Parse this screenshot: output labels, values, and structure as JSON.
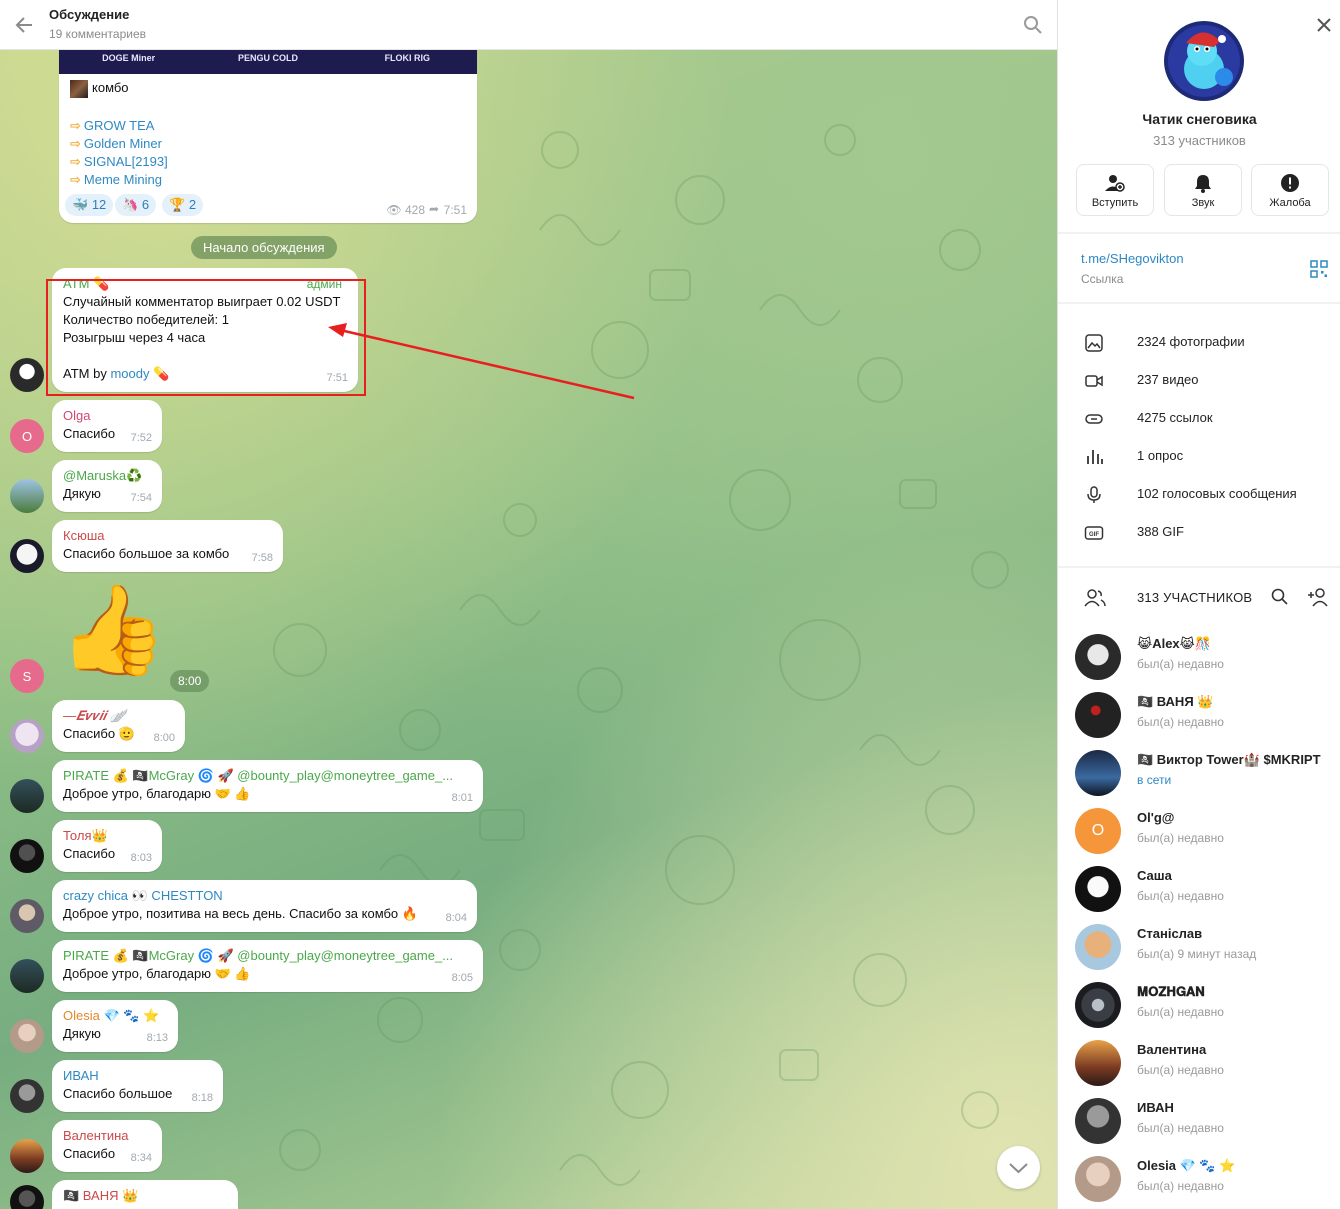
{
  "header": {
    "title": "Обсуждение",
    "subtitle": "19 комментариев"
  },
  "post": {
    "banner": [
      "DOGE Miner",
      "PENGU COLD",
      "FLOKI RIG"
    ],
    "combo": "комбо",
    "links": [
      "GROW TEA",
      "Golden Miner",
      "SIGNAL[2193]",
      "Meme Mining"
    ],
    "reactions": [
      {
        "emoji": "🐳",
        "count": "12"
      },
      {
        "emoji": "🦄",
        "count": "6"
      },
      {
        "emoji": "🏆",
        "count": "2"
      }
    ],
    "views": "428",
    "time": "7:51"
  },
  "discussion_start": "Начало обсуждения",
  "messages": [
    {
      "name": "ATM 💊",
      "badge": "админ",
      "lines": [
        "Случайный комментатор выиграет 0.02 USDT",
        "Количество победителей: 1",
        "Розыгрыш через 4 часа"
      ],
      "footer_text": "ATM by ",
      "footer_link": "moody 💊",
      "time": "7:51"
    },
    {
      "name": "Olga",
      "text": "Спасибо",
      "time": "7:52",
      "avatar_letter": "O"
    },
    {
      "name": "@Maruska♻️",
      "text": "Дякую",
      "time": "7:54"
    },
    {
      "name": "Ксюша",
      "text": "Спасибо большое за комбо",
      "time": "7:58"
    },
    {
      "sticker": "👍",
      "time": "8:00",
      "avatar_letter": "S"
    },
    {
      "name": "—𝑬𝒗𝒗𝒊𝒊 🪽",
      "text": "Спасибо 🫡",
      "time": "8:00"
    },
    {
      "name": "PIRATE 💰 🏴‍☠️McGray 🌀 🚀 @bounty_play@moneytree_game_...",
      "text": "Доброе утро, благодарю 🤝 👍",
      "time": "8:01"
    },
    {
      "name": "Толя👑",
      "text": "Спасибо",
      "time": "8:03"
    },
    {
      "name": "crazy chica 👀 CHESTTON",
      "text": "Доброе утро, позитива на весь день. Спасибо за комбо 🔥",
      "time": "8:04"
    },
    {
      "name": "PIRATE 💰 🏴‍☠️McGray 🌀 🚀 @bounty_play@moneytree_game_...",
      "text": "Доброе утро, благодарю 🤝 👍",
      "time": "8:05"
    },
    {
      "name": "Olesia 💎 🐾 ⭐",
      "text": "Дякую",
      "time": "8:13"
    },
    {
      "name": "ИВАН",
      "text": "Спасибо большое",
      "time": "8:18"
    },
    {
      "name": "Валентина",
      "text": "Спасибо",
      "time": "8:34"
    },
    {
      "name": "🏴‍☠️ ВАНЯ 👑",
      "text": "",
      "time": ""
    }
  ],
  "panel": {
    "group_name": "Чатик снеговика",
    "group_count": "313 участников",
    "actions": [
      {
        "label": "Вступить",
        "icon": "add-user-icon"
      },
      {
        "label": "Звук",
        "icon": "bell-icon"
      },
      {
        "label": "Жалоба",
        "icon": "alert-icon"
      }
    ],
    "link": "t.me/SHegovikton",
    "link_caption": "Ссылка",
    "media": [
      {
        "label": "2324 фотографии",
        "icon": "photo-icon"
      },
      {
        "label": "237 видео",
        "icon": "video-icon"
      },
      {
        "label": "4275 ссылок",
        "icon": "link-icon"
      },
      {
        "label": "1 опрос",
        "icon": "poll-icon"
      },
      {
        "label": "102 голосовых сообщения",
        "icon": "microphone-icon"
      },
      {
        "label": "388 GIF",
        "icon": "gif-icon"
      }
    ],
    "members_header": "313 УЧАСТНИКОВ",
    "members": [
      {
        "name": "😹Alex😹🎊",
        "status": "был(а) недавно"
      },
      {
        "name": "🏴‍☠️ ВАНЯ 👑",
        "status": "был(а) недавно"
      },
      {
        "name": "🏴‍☠️ Виктор Tower🏰 $MKRIPT",
        "status": "в сети"
      },
      {
        "name": "Ol'g@",
        "status": "был(а) недавно",
        "letter": "O"
      },
      {
        "name": "Саша",
        "status": "был(а) недавно"
      },
      {
        "name": "Станіслав",
        "status": "был(а) 9 минут назад"
      },
      {
        "name": "𝐌𝐎𝐙𝐇𝐆𝐀𝐍",
        "status": "был(а) недавно"
      },
      {
        "name": "Валентина",
        "status": "был(а) недавно"
      },
      {
        "name": "ИВАН",
        "status": "был(а) недавно"
      },
      {
        "name": "Olesia 💎 🐾 ⭐",
        "status": "был(а) недавно"
      }
    ]
  },
  "colors": {
    "link": "#2e89c3",
    "highlight": "#e81f1f",
    "admin_name": "#4aa84a"
  }
}
